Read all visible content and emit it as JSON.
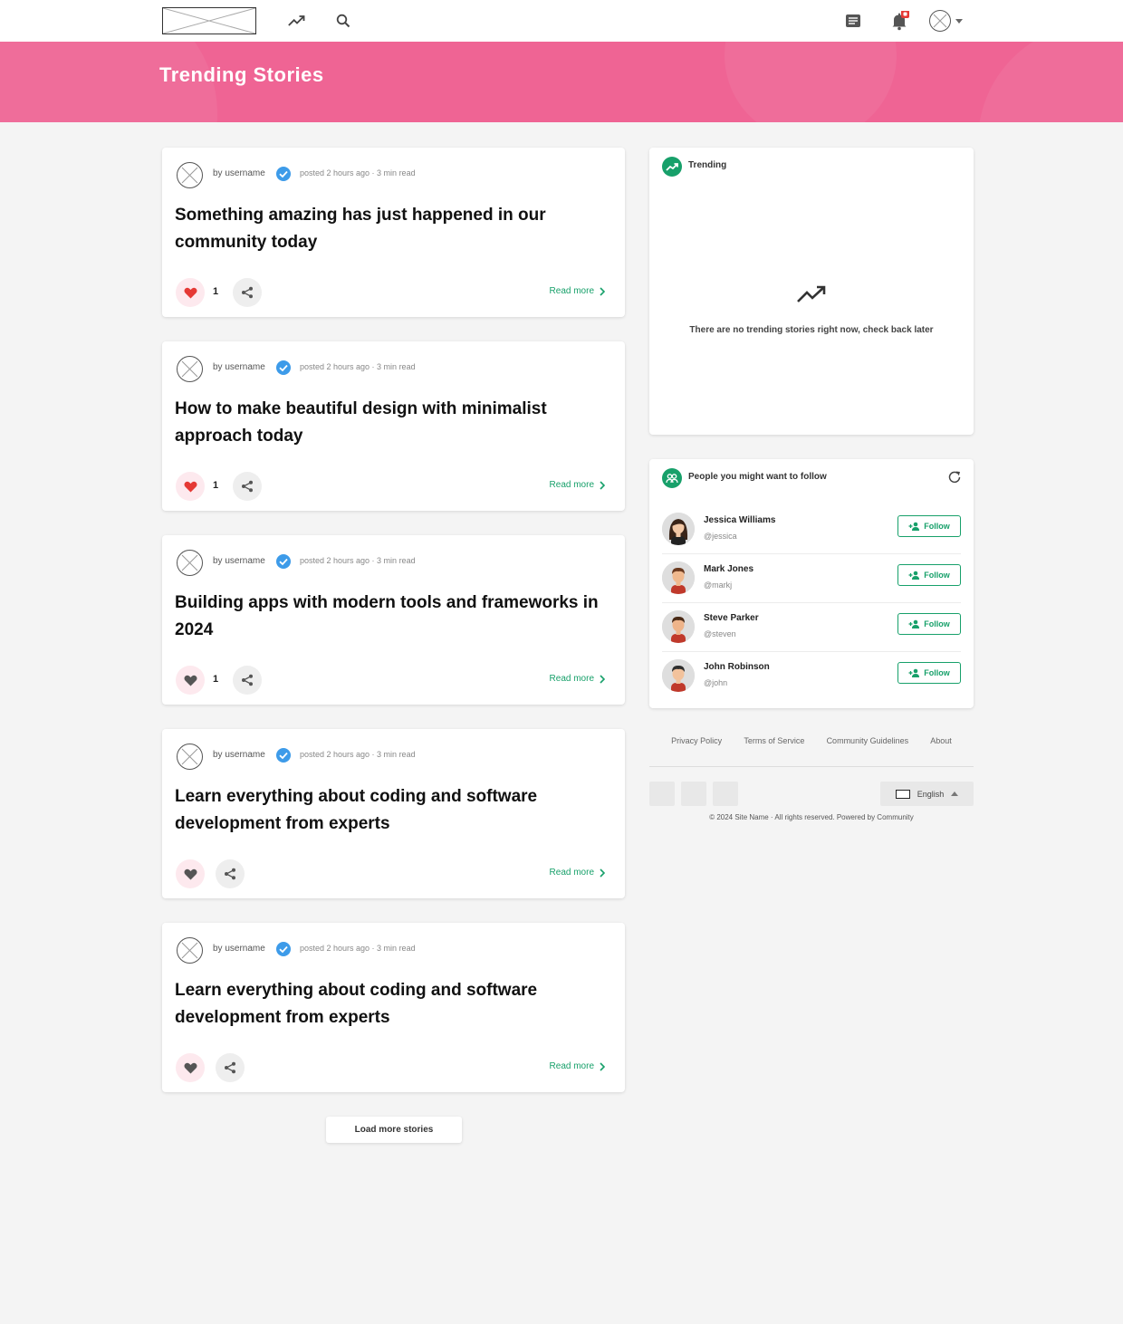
{
  "header": {
    "icons": [
      "logo-placeholder",
      "trending-icon",
      "search-icon",
      "messages-icon",
      "notification-bell-icon",
      "user-avatar-icon",
      "caret-down-icon"
    ],
    "notification_badge_color": "#e53935"
  },
  "banner": {
    "title": "Trending Stories",
    "background": "#ef6494"
  },
  "feed": {
    "posts": [
      {
        "author": "by username",
        "meta": "posted 2 hours ago · 3 min read",
        "title": "Something amazing has just happened in our community today",
        "likes": "1",
        "liked": true,
        "read_more": "Read more"
      },
      {
        "author": "by username",
        "meta": "posted 2 hours ago · 3 min read",
        "title": "How to make beautiful design with minimalist approach today",
        "likes": "1",
        "liked": true,
        "read_more": "Read more"
      },
      {
        "author": "by username",
        "meta": "posted 2 hours ago · 3 min read",
        "title": "Building apps with modern tools and frameworks in 2024",
        "likes": "1",
        "liked": false,
        "read_more": "Read more"
      },
      {
        "author": "by username",
        "meta": "posted 2 hours ago · 3 min read",
        "title": "Learn everything about coding and software development from experts",
        "likes": "",
        "liked": false,
        "read_more": "Read more"
      },
      {
        "author": "by username",
        "meta": "posted 2 hours ago · 3 min read",
        "title": "Learn everything about coding and software development from experts",
        "likes": "",
        "liked": false,
        "read_more": "Read more"
      }
    ],
    "load_more": "Load more stories"
  },
  "sidebar": {
    "trending": {
      "title": "Trending",
      "empty_text": "There are no trending stories right now, check back later"
    },
    "suggestions": {
      "title": "People you might want to follow",
      "follow_label": "Follow",
      "users": [
        {
          "name": "Jessica Williams",
          "handle": "@jessica"
        },
        {
          "name": "Mark Jones",
          "handle": "@markj"
        },
        {
          "name": "Steve Parker",
          "handle": "@steven"
        },
        {
          "name": "John Robinson",
          "handle": "@john"
        }
      ]
    },
    "footer": {
      "links": [
        "Privacy Policy",
        "Terms of Service",
        "Community Guidelines",
        "About"
      ],
      "language": "English",
      "copyright": "© 2024 Site Name · All rights reserved. Powered by Community"
    }
  },
  "colors": {
    "accent": "#17a06a",
    "like_active": "#e53935",
    "like_inactive": "#555555",
    "verified": "#3d9be9"
  }
}
